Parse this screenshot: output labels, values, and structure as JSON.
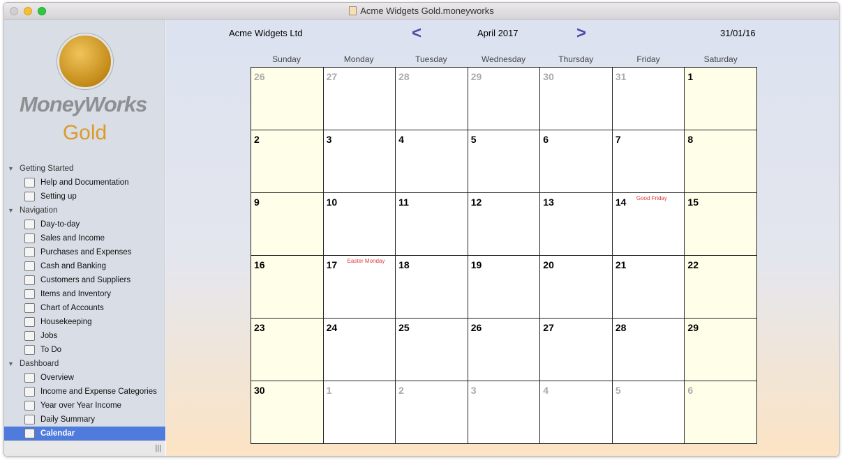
{
  "window": {
    "title": "Acme Widgets Gold.moneyworks"
  },
  "logo": {
    "brand": "MoneyWorks",
    "edition": "Gold"
  },
  "sidebar": {
    "sections": [
      {
        "label": "Getting Started",
        "items": [
          {
            "label": "Help and Documentation",
            "icon": "info-icon"
          },
          {
            "label": "Setting up",
            "icon": "setup-document-icon"
          }
        ]
      },
      {
        "label": "Navigation",
        "items": [
          {
            "label": "Day-to-day",
            "icon": "calendar-icon"
          },
          {
            "label": "Sales and Income",
            "icon": "cash-register-icon"
          },
          {
            "label": "Purchases and Expenses",
            "icon": "cheque-pen-icon"
          },
          {
            "label": "Cash and Banking",
            "icon": "coins-icon"
          },
          {
            "label": "Customers and Suppliers",
            "icon": "people-icon"
          },
          {
            "label": "Items and Inventory",
            "icon": "box-icon"
          },
          {
            "label": "Chart of Accounts",
            "icon": "ledger-book-icon"
          },
          {
            "label": "Housekeeping",
            "icon": "folder-icon"
          },
          {
            "label": "Jobs",
            "icon": "clipboard-clock-icon"
          },
          {
            "label": "To Do",
            "icon": "note-pin-icon"
          }
        ]
      },
      {
        "label": "Dashboard",
        "items": [
          {
            "label": "Overview",
            "icon": "chart-icon"
          },
          {
            "label": "Income and Expense Categories",
            "icon": "chart-icon"
          },
          {
            "label": "Year over Year Income",
            "icon": "chart-icon"
          },
          {
            "label": "Daily Summary",
            "icon": "chart-icon"
          },
          {
            "label": "Calendar",
            "icon": "calendar-grid-icon",
            "selected": true
          }
        ]
      }
    ]
  },
  "header": {
    "company": "Acme Widgets Ltd",
    "month": "April 2017",
    "date": "31/01/16"
  },
  "colors": {
    "accent": "#4f7bdc",
    "holiday": "#e03a3a",
    "weekend": "#fefee9",
    "arrow": "#4a4aaa"
  },
  "calendar": {
    "days": [
      "Sunday",
      "Monday",
      "Tuesday",
      "Wednesday",
      "Thursday",
      "Friday",
      "Saturday"
    ],
    "weeks": [
      [
        {
          "d": "26",
          "o": true
        },
        {
          "d": "27",
          "o": true
        },
        {
          "d": "28",
          "o": true
        },
        {
          "d": "29",
          "o": true
        },
        {
          "d": "30",
          "o": true
        },
        {
          "d": "31",
          "o": true
        },
        {
          "d": "1"
        }
      ],
      [
        {
          "d": "2"
        },
        {
          "d": "3"
        },
        {
          "d": "4"
        },
        {
          "d": "5"
        },
        {
          "d": "6"
        },
        {
          "d": "7"
        },
        {
          "d": "8"
        }
      ],
      [
        {
          "d": "9"
        },
        {
          "d": "10"
        },
        {
          "d": "11"
        },
        {
          "d": "12"
        },
        {
          "d": "13"
        },
        {
          "d": "14",
          "h": "Good Friday"
        },
        {
          "d": "15"
        }
      ],
      [
        {
          "d": "16"
        },
        {
          "d": "17",
          "h": "Easter Monday"
        },
        {
          "d": "18"
        },
        {
          "d": "19"
        },
        {
          "d": "20"
        },
        {
          "d": "21"
        },
        {
          "d": "22"
        }
      ],
      [
        {
          "d": "23"
        },
        {
          "d": "24"
        },
        {
          "d": "25"
        },
        {
          "d": "26"
        },
        {
          "d": "27"
        },
        {
          "d": "28"
        },
        {
          "d": "29"
        }
      ],
      [
        {
          "d": "30"
        },
        {
          "d": "1",
          "o": true
        },
        {
          "d": "2",
          "o": true
        },
        {
          "d": "3",
          "o": true
        },
        {
          "d": "4",
          "o": true
        },
        {
          "d": "5",
          "o": true
        },
        {
          "d": "6",
          "o": true
        }
      ]
    ]
  }
}
